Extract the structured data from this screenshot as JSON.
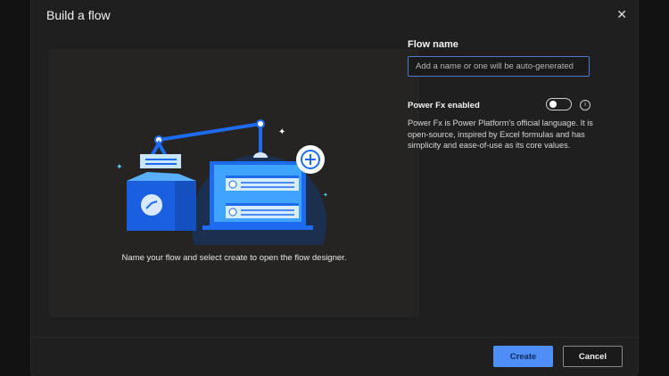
{
  "dialog": {
    "title": "Build a flow",
    "close_icon": "✕",
    "caption": "Name your flow and select create to open the flow designer.",
    "flow_name": {
      "label": "Flow name",
      "value": "",
      "placeholder": "Add a name or one will be auto-generated"
    },
    "power_fx": {
      "label": "Power Fx enabled",
      "enabled": false,
      "info_icon": "i",
      "description": "Power Fx is Power Platform's official language. It is open-source, inspired by Excel formulas and has simplicity and ease-of-use as its core values."
    },
    "buttons": {
      "create": "Create",
      "cancel": "Cancel"
    }
  },
  "colors": {
    "accent": "#4f8ef7",
    "background": "#201f1f"
  }
}
